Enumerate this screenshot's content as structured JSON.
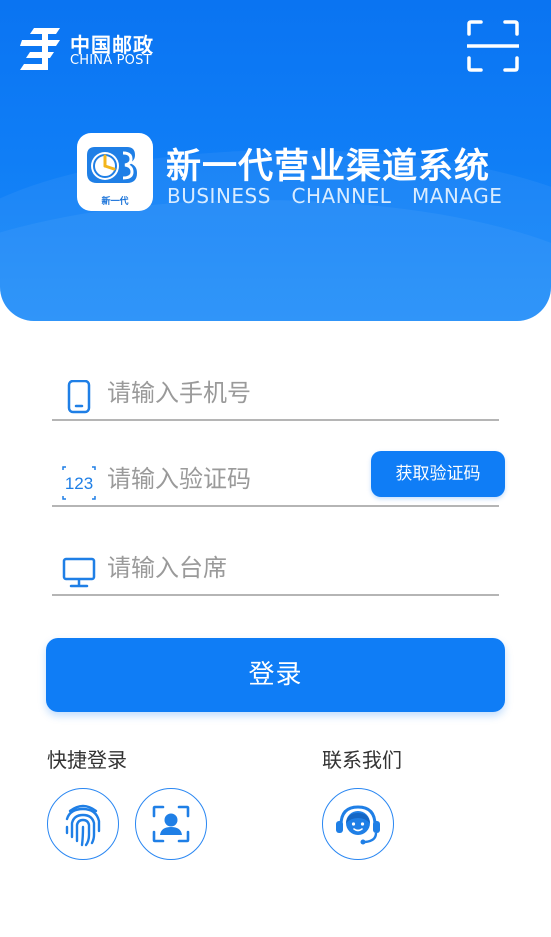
{
  "header": {
    "logo_cn": "中国邮政",
    "logo_en": "CHINA POST",
    "app_icon_label": "新一代",
    "app_title": "新一代营业渠道系统",
    "app_subtitle": "BUSINESS   CHANNEL   MANAGE"
  },
  "form": {
    "phone_placeholder": "请输入手机号",
    "code_placeholder": "请输入验证码",
    "seat_placeholder": "请输入台席",
    "get_code_label": "获取验证码",
    "login_label": "登录"
  },
  "icons": {
    "phone": "phone-icon",
    "code": "numeric-123-icon",
    "seat": "monitor-icon",
    "scan": "scan-icon",
    "fingerprint": "fingerprint-icon",
    "face": "face-scan-icon",
    "support": "headset-support-icon"
  },
  "bottom": {
    "quick_login_label": "快捷登录",
    "contact_label": "联系我们"
  },
  "colors": {
    "primary": "#0f7df6",
    "divider": "#b5b5b5",
    "placeholder": "#9a9a9a"
  }
}
